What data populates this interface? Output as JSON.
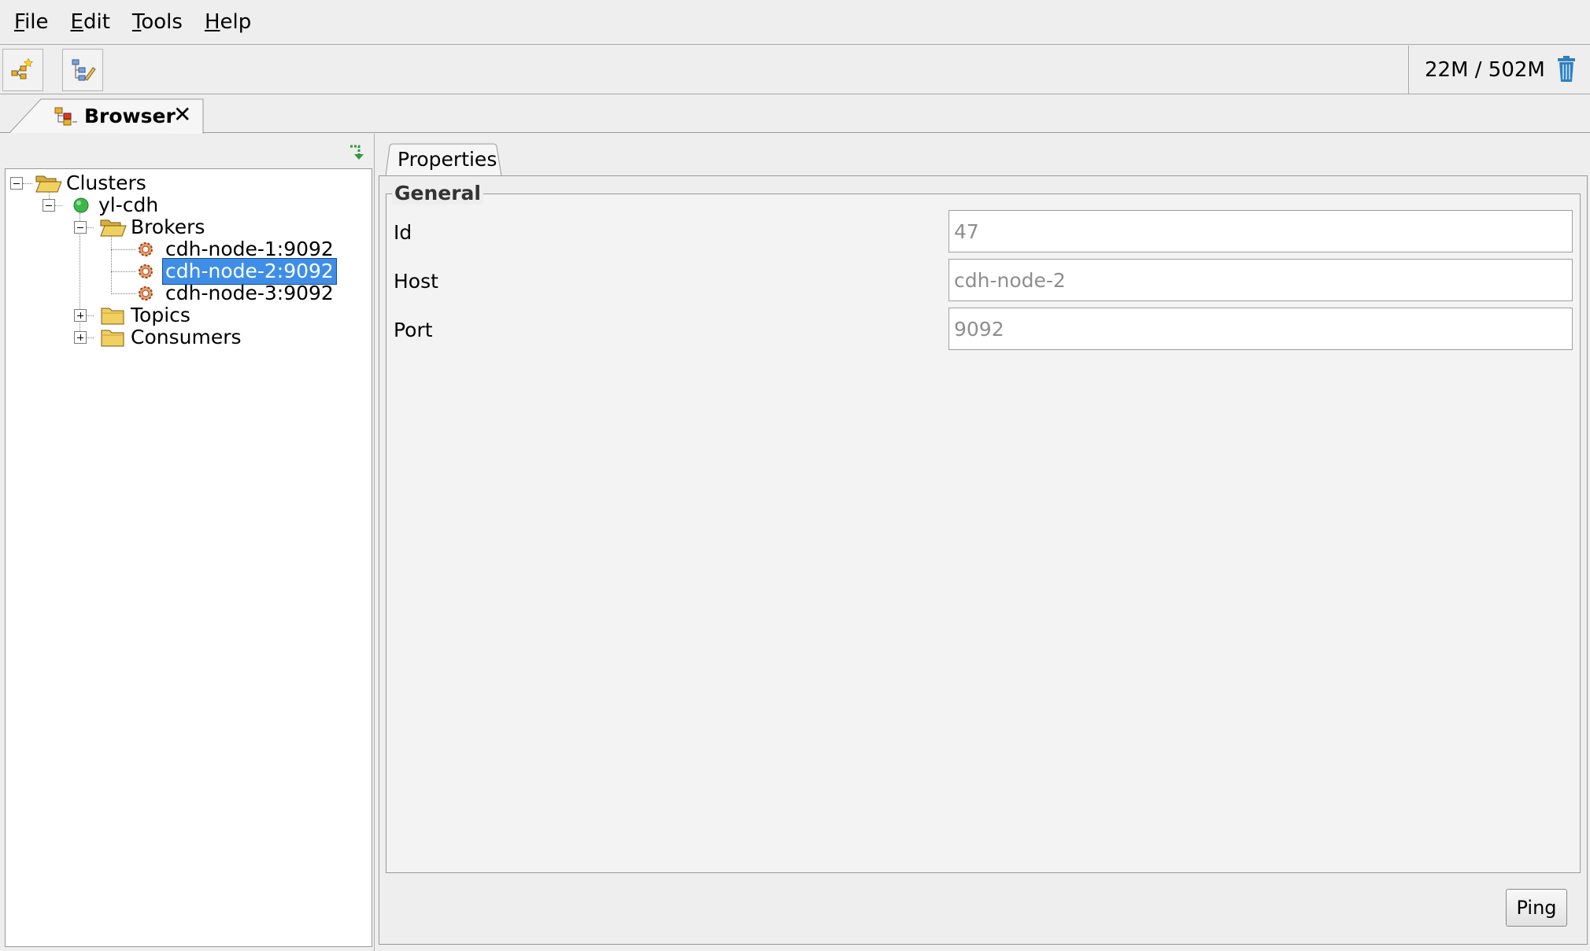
{
  "menu": [
    {
      "mnemonic": "F",
      "rest": "ile"
    },
    {
      "mnemonic": "E",
      "rest": "dit"
    },
    {
      "mnemonic": "T",
      "rest": "ools"
    },
    {
      "mnemonic": "H",
      "rest": "elp"
    }
  ],
  "toolbar": {
    "memory": "22M / 502M",
    "icons": [
      "add-cluster-icon",
      "edit-tree-icon",
      "trash-icon"
    ]
  },
  "tabs": {
    "browser": {
      "label": "Browser",
      "close": "✕"
    }
  },
  "tree": {
    "clusters": "Clusters",
    "cluster": "yl-cdh",
    "brokers": "Brokers",
    "broker_nodes": [
      "cdh-node-1:9092",
      "cdh-node-2:9092",
      "cdh-node-3:9092"
    ],
    "selected": "cdh-node-2:9092",
    "topics": "Topics",
    "consumers": "Consumers"
  },
  "properties": {
    "tab_label": "Properties",
    "group_title": "General",
    "fields": [
      {
        "label": "Id",
        "value": "47"
      },
      {
        "label": "Host",
        "value": "cdh-node-2"
      },
      {
        "label": "Port",
        "value": "9092"
      }
    ],
    "ping_label": "Ping"
  },
  "colors": {
    "selection": "#3e8ee8",
    "status_online": "#3cb84a",
    "folder": "#e8c44a",
    "trash": "#2f7fc0"
  }
}
